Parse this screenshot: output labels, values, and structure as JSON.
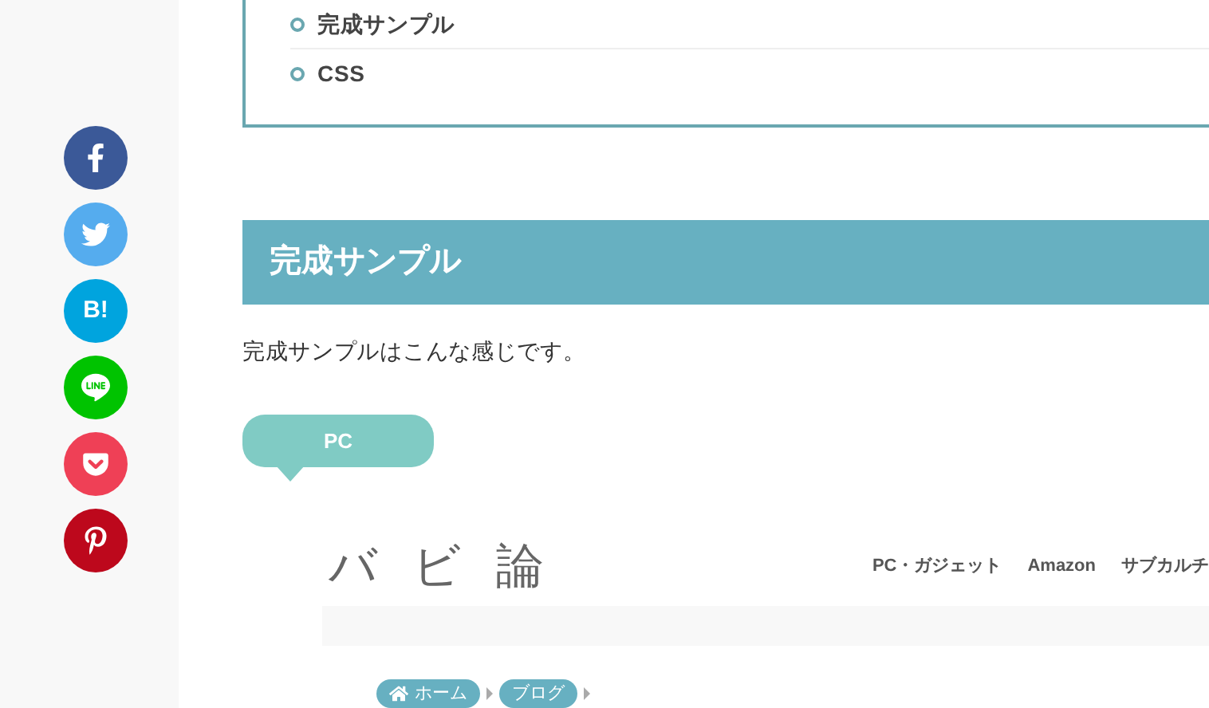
{
  "share_buttons": [
    {
      "kind": "facebook",
      "color": "#3b5998"
    },
    {
      "kind": "twitter",
      "color": "#55acee"
    },
    {
      "kind": "hatena",
      "label": "B!",
      "color": "#00a4de"
    },
    {
      "kind": "line",
      "color": "#00c300"
    },
    {
      "kind": "pocket",
      "color": "#ef4056"
    },
    {
      "kind": "pinterest",
      "color": "#bd081c"
    }
  ],
  "toc": {
    "items": [
      "完成サンプル",
      "CSS"
    ]
  },
  "section": {
    "heading": "完成サンプル",
    "text": "完成サンプルはこんな感じです。",
    "bubble": "PC"
  },
  "sample_screenshot": {
    "logo": "バ ビ 論",
    "nav": [
      "PC・ガジェット",
      "Amazon",
      "サブカルチ"
    ],
    "breadcrumb": [
      "ホーム",
      "ブログ"
    ]
  }
}
